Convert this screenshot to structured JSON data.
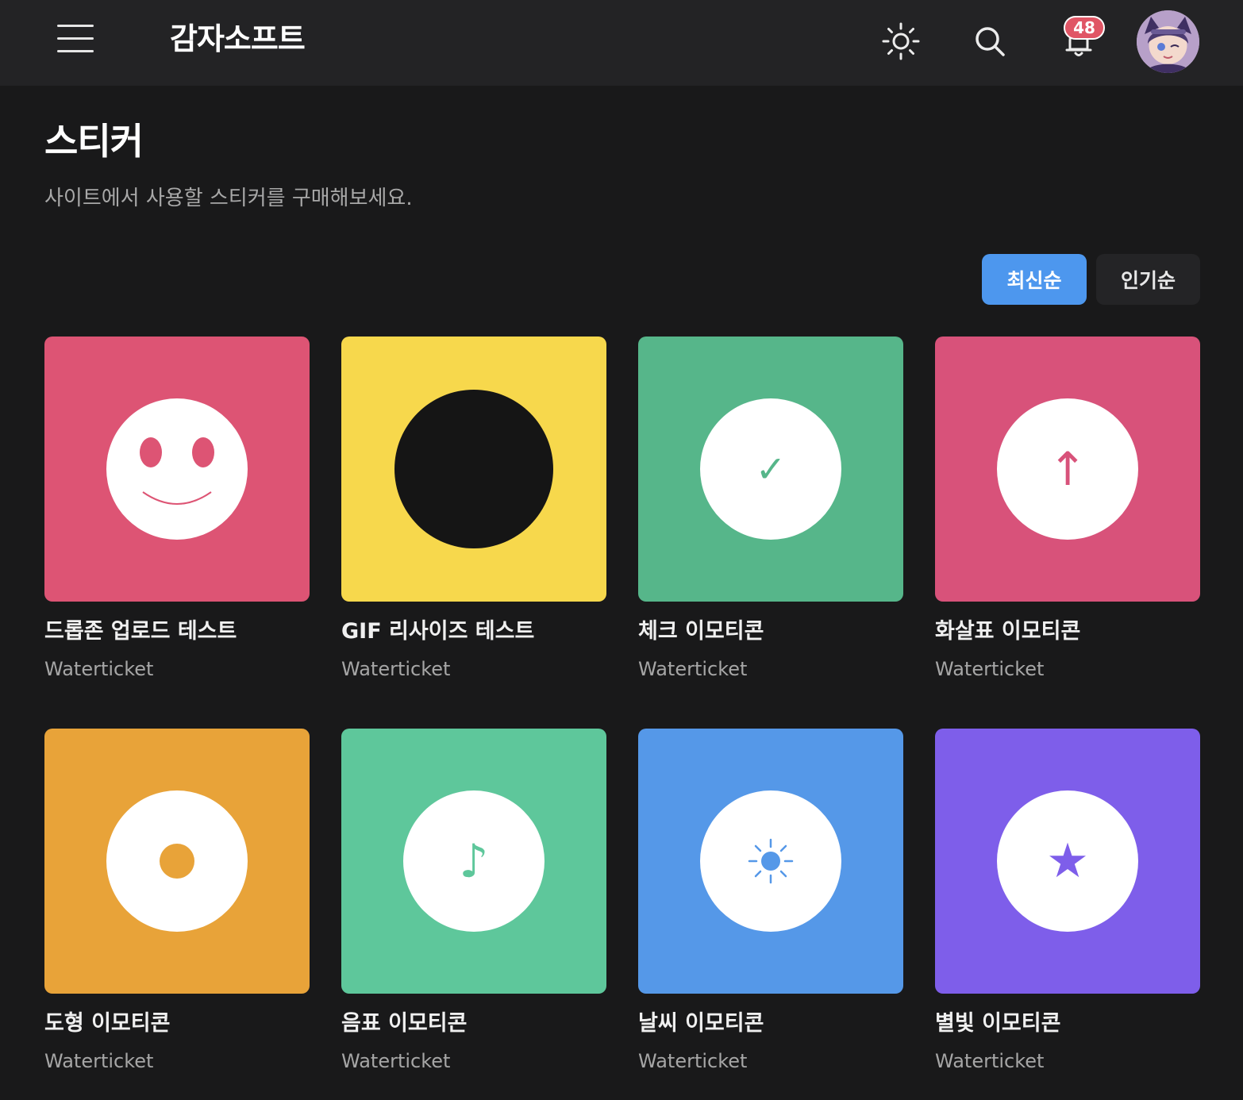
{
  "header": {
    "brand": "감자소프트",
    "notification_count": "48"
  },
  "page": {
    "title": "스티커",
    "description": "사이트에서 사용할 스티커를 구매해보세요."
  },
  "sort": {
    "latest_label": "최신순",
    "popular_label": "인기순",
    "selected": "최신순"
  },
  "stickers": [
    {
      "title": "드롭존 업로드 테스트",
      "author": "Waterticket",
      "bg": "#dd5474",
      "icon": "smiley-face-icon"
    },
    {
      "title": "GIF 리사이즈 테스트",
      "author": "Waterticket",
      "bg": "#f7d84c",
      "icon": "black-circle-icon"
    },
    {
      "title": "체크 이모티콘",
      "author": "Waterticket",
      "bg": "#56b68a",
      "icon": "check-icon",
      "glyph": "✓",
      "glyph_color": "#56b68a"
    },
    {
      "title": "화살표 이모티콘",
      "author": "Waterticket",
      "bg": "#d8527a",
      "icon": "arrow-up-icon",
      "glyph": "↑",
      "glyph_color": "#d8527a"
    },
    {
      "title": "도형 이모티콘",
      "author": "Waterticket",
      "bg": "#e8a339",
      "icon": "dot-icon"
    },
    {
      "title": "음표 이모티콘",
      "author": "Waterticket",
      "bg": "#5ec79b",
      "icon": "music-note-icon",
      "glyph": "♪",
      "glyph_color": "#5ec79b"
    },
    {
      "title": "날씨 이모티콘",
      "author": "Waterticket",
      "bg": "#5598e8",
      "icon": "sun-icon"
    },
    {
      "title": "별빛 이모티콘",
      "author": "Waterticket",
      "bg": "#7e5eea",
      "icon": "star-icon",
      "glyph": "★",
      "glyph_color": "#7e5eea"
    }
  ]
}
